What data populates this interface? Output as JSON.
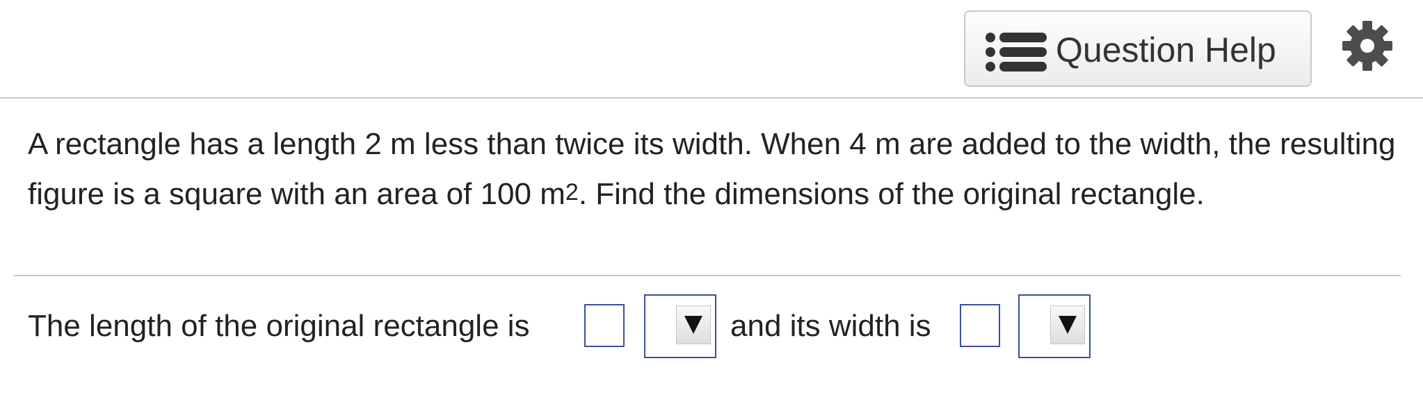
{
  "header": {
    "help_button": {
      "label": "Question Help",
      "icon": "list-icon"
    },
    "settings": {
      "icon": "gear-icon"
    }
  },
  "question": {
    "text_before": "A rectangle has a length 2 m less than twice its width. When 4 m are added to the width, the resulting figure is a square with an area of 100 m",
    "superscript": "2",
    "text_after": ". Find the dimensions of the original rectangle."
  },
  "answer": {
    "part1": "The length of the original rectangle is",
    "part2": "and its width is",
    "length_value": "",
    "length_unit": "",
    "width_value": "",
    "width_unit": ""
  },
  "colors": {
    "input_border": "#3a4fa0",
    "divider": "#c9c9c9",
    "icon": "#333333"
  }
}
